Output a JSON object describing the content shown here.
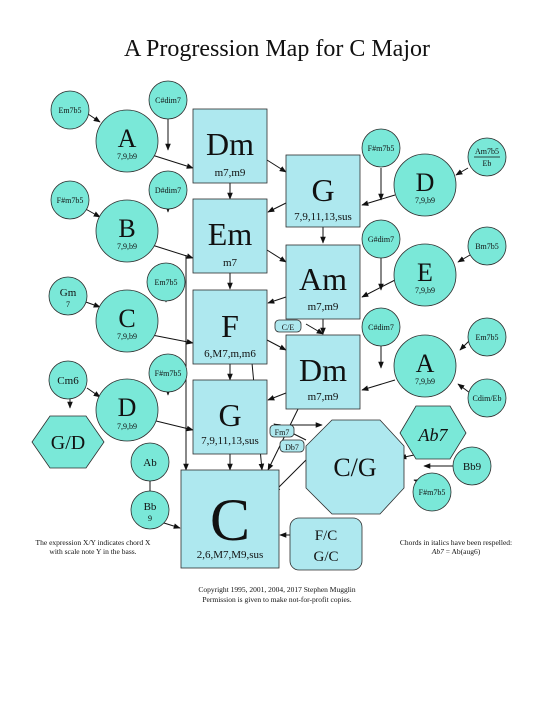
{
  "title": "A Progression Map for C Major",
  "colors": {
    "box": "#aee8ef",
    "circle": "#7ae8d8",
    "stroke": "#2d2d2d"
  },
  "main_chords": {
    "dm_top": {
      "name": "Dm",
      "ext": "m7,m9"
    },
    "g_top": {
      "name": "G",
      "ext": "7,9,11,13,sus"
    },
    "em": {
      "name": "Em",
      "ext": "m7"
    },
    "am": {
      "name": "Am",
      "ext": "m7,m9"
    },
    "f": {
      "name": "F",
      "ext": "6,M7,m,m6"
    },
    "dm_low": {
      "name": "Dm",
      "ext": "m7,m9"
    },
    "g_low": {
      "name": "G",
      "ext": "7,9,11,13,sus"
    },
    "c": {
      "name": "C",
      "ext": "2,6,M7,M9,sus"
    }
  },
  "secondary": {
    "a_left": {
      "name": "A",
      "ext": "7,9,b9"
    },
    "b_left": {
      "name": "B",
      "ext": "7,9,b9"
    },
    "c_left": {
      "name": "C",
      "ext": "7,9,b9"
    },
    "d_left": {
      "name": "D",
      "ext": "7,9,b9"
    },
    "d_right": {
      "name": "D",
      "ext": "7,9,b9"
    },
    "e_right": {
      "name": "E",
      "ext": "7,9,b9"
    },
    "a_right": {
      "name": "A",
      "ext": "7,9,b9"
    }
  },
  "small_chords": {
    "em7b5_a": "Em7b5",
    "csdim7": "C#dim7",
    "fsm7b5_b": "F#m7b5",
    "dsdim7": "D#dim7",
    "gm": "Gm",
    "gm_sub": "7",
    "em7b5_c": "Em7b5",
    "cm6": "Cm6",
    "fsm7b5_d": "F#m7b5",
    "ab": "Ab",
    "bb": "Bb",
    "bb_sub": "9",
    "fsm7b5_r": "F#m7b5",
    "am7b5_top": "Am7b5",
    "am7b5_bot": "Eb",
    "gsdim7": "G#dim7",
    "bm7b5": "Bm7b5",
    "csdim7_r": "C#dim7",
    "em7b5_r": "Em7b5",
    "cdim_eb": "Cdim/Eb",
    "bb9": "Bb9",
    "fsm7b5_cg": "F#m7b5"
  },
  "labels": {
    "ce": "C/E",
    "fm7": "Fm7",
    "db7": "Db7",
    "gd": "G/D",
    "cg": "C/G",
    "ab7": "Ab7",
    "fc": "F/C",
    "gc": "G/C"
  },
  "notes": {
    "left_line1": "The expression X/Y indicates chord X",
    "left_line2": "with scale note Y in the bass.",
    "right_line1": "Chords in italics have been respelled:",
    "right_line2_a": "Ab7",
    "right_line2_b": " = Ab(aug6)",
    "copyright1": "Copyright 1995, 2001, 2004, 2017 Stephen Mugglin",
    "copyright2": "Permission is given to make not-for-profit copies."
  }
}
